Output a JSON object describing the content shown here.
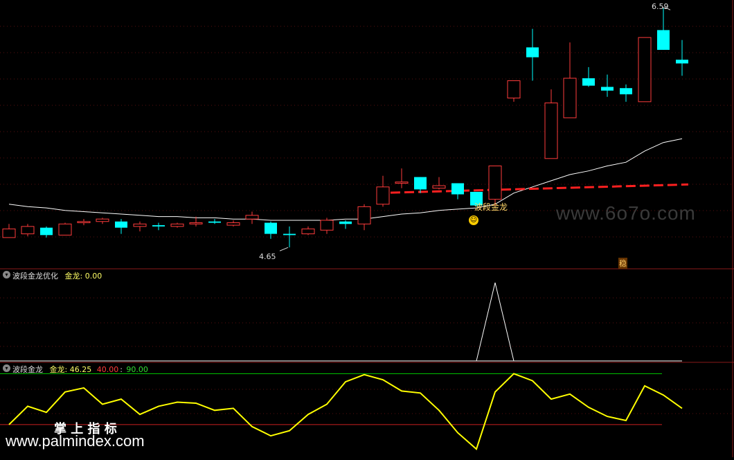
{
  "main_panel": {
    "high_label": "6.59",
    "low_label": "4.65",
    "signal_label": "波段金龙",
    "marker_label": "稳"
  },
  "indicator1": {
    "name": "波段金龙优化",
    "field": "金龙: 0.00"
  },
  "indicator2": {
    "name": "波段金龙",
    "field": "金龙: 46.25",
    "level_low": "40.00",
    "level_high": "90.00"
  },
  "watermarks": {
    "site1": "www.6o7o.com",
    "brand": "掌 上 指 标",
    "site2": "www.palmindex.com"
  },
  "colors": {
    "up": "#ff3b3b",
    "down": "#00ffff",
    "ma": "#ffffff",
    "dashed": "#ff2020",
    "osc": "#ffff00",
    "level_high": "#00cc00",
    "level_low": "#cc2020"
  },
  "chart_data": [
    {
      "type": "candlestick",
      "title": "",
      "ylim": [
        4.55,
        6.62
      ],
      "candles": [
        {
          "o": 4.73,
          "h": 4.84,
          "l": 4.73,
          "c": 4.8,
          "dir": "up"
        },
        {
          "o": 4.76,
          "h": 4.84,
          "l": 4.74,
          "c": 4.82,
          "dir": "up"
        },
        {
          "o": 4.81,
          "h": 4.82,
          "l": 4.73,
          "c": 4.75,
          "dir": "down"
        },
        {
          "o": 4.75,
          "h": 4.85,
          "l": 4.75,
          "c": 4.84,
          "dir": "up"
        },
        {
          "o": 4.85,
          "h": 4.88,
          "l": 4.83,
          "c": 4.86,
          "dir": "up"
        },
        {
          "o": 4.88,
          "h": 4.89,
          "l": 4.84,
          "c": 4.86,
          "dir": "up"
        },
        {
          "o": 4.86,
          "h": 4.88,
          "l": 4.76,
          "c": 4.81,
          "dir": "down"
        },
        {
          "o": 4.82,
          "h": 4.86,
          "l": 4.78,
          "c": 4.84,
          "dir": "up"
        },
        {
          "o": 4.83,
          "h": 4.85,
          "l": 4.79,
          "c": 4.82,
          "dir": "down"
        },
        {
          "o": 4.82,
          "h": 4.85,
          "l": 4.81,
          "c": 4.84,
          "dir": "up"
        },
        {
          "o": 4.84,
          "h": 4.9,
          "l": 4.82,
          "c": 4.85,
          "dir": "up"
        },
        {
          "o": 4.86,
          "h": 4.88,
          "l": 4.84,
          "c": 4.85,
          "dir": "down"
        },
        {
          "o": 4.83,
          "h": 4.87,
          "l": 4.82,
          "c": 4.85,
          "dir": "up"
        },
        {
          "o": 4.88,
          "h": 4.94,
          "l": 4.84,
          "c": 4.91,
          "dir": "up"
        },
        {
          "o": 4.85,
          "h": 4.86,
          "l": 4.72,
          "c": 4.76,
          "dir": "down"
        },
        {
          "o": 4.75,
          "h": 4.82,
          "l": 4.65,
          "c": 4.76,
          "dir": "down"
        },
        {
          "o": 4.76,
          "h": 4.82,
          "l": 4.75,
          "c": 4.8,
          "dir": "up"
        },
        {
          "o": 4.79,
          "h": 4.89,
          "l": 4.76,
          "c": 4.87,
          "dir": "up"
        },
        {
          "o": 4.86,
          "h": 4.87,
          "l": 4.8,
          "c": 4.84,
          "dir": "down"
        },
        {
          "o": 4.84,
          "h": 5.0,
          "l": 4.79,
          "c": 4.98,
          "dir": "up"
        },
        {
          "o": 5.0,
          "h": 5.23,
          "l": 4.98,
          "c": 5.14,
          "dir": "up"
        },
        {
          "o": 5.17,
          "h": 5.29,
          "l": 5.13,
          "c": 5.18,
          "dir": "up"
        },
        {
          "o": 5.22,
          "h": 5.22,
          "l": 5.09,
          "c": 5.12,
          "dir": "down"
        },
        {
          "o": 5.13,
          "h": 5.22,
          "l": 5.12,
          "c": 5.15,
          "dir": "up"
        },
        {
          "o": 5.17,
          "h": 5.17,
          "l": 5.04,
          "c": 5.08,
          "dir": "down"
        },
        {
          "o": 5.1,
          "h": 5.1,
          "l": 4.98,
          "c": 4.99,
          "dir": "down"
        },
        {
          "o": 5.04,
          "h": 5.31,
          "l": 4.99,
          "c": 5.31,
          "dir": "up"
        },
        {
          "o": 5.86,
          "h": 6.0,
          "l": 5.83,
          "c": 6.0,
          "dir": "up"
        },
        {
          "o": 6.27,
          "h": 6.42,
          "l": 6.0,
          "c": 6.19,
          "dir": "down"
        },
        {
          "o": 5.37,
          "h": 5.93,
          "l": 5.37,
          "c": 5.82,
          "dir": "up"
        },
        {
          "o": 5.7,
          "h": 6.31,
          "l": 5.7,
          "c": 6.02,
          "dir": "up"
        },
        {
          "o": 6.02,
          "h": 6.11,
          "l": 5.95,
          "c": 5.96,
          "dir": "down"
        },
        {
          "o": 5.95,
          "h": 6.05,
          "l": 5.87,
          "c": 5.92,
          "dir": "down"
        },
        {
          "o": 5.94,
          "h": 5.97,
          "l": 5.83,
          "c": 5.89,
          "dir": "down"
        },
        {
          "o": 5.83,
          "h": 6.35,
          "l": 5.83,
          "c": 6.35,
          "dir": "up"
        },
        {
          "o": 6.41,
          "h": 6.59,
          "l": 6.25,
          "c": 6.25,
          "dir": "down"
        },
        {
          "o": 6.17,
          "h": 6.33,
          "l": 6.04,
          "c": 6.14,
          "dir": "down"
        }
      ],
      "ma": [
        5.0,
        4.98,
        4.97,
        4.95,
        4.94,
        4.93,
        4.92,
        4.91,
        4.9,
        4.9,
        4.89,
        4.89,
        4.88,
        4.88,
        4.87,
        4.87,
        4.87,
        4.87,
        4.88,
        4.88,
        4.9,
        4.92,
        4.93,
        4.95,
        4.96,
        4.97,
        5.0,
        5.09,
        5.14,
        5.19,
        5.24,
        5.27,
        5.31,
        5.34,
        5.43,
        5.5,
        5.53
      ],
      "dashed_level": {
        "start_index": 20,
        "start": 5.09,
        "end": 5.16
      }
    },
    {
      "type": "line",
      "title": "",
      "ylim": [
        0,
        100
      ],
      "values": [
        0,
        0,
        0,
        0,
        0,
        0,
        0,
        0,
        0,
        0,
        0,
        0,
        0,
        0,
        0,
        0,
        0,
        0,
        0,
        0,
        0,
        0,
        0,
        0,
        0,
        0,
        100,
        0,
        0,
        0,
        0,
        0,
        0,
        0,
        0,
        0,
        0
      ]
    },
    {
      "type": "line",
      "title": "",
      "ylim": [
        10,
        95
      ],
      "levels": [
        40,
        90
      ],
      "values": [
        40,
        58,
        52,
        72,
        76,
        60,
        65,
        50,
        58,
        62,
        61,
        54,
        56,
        38,
        29,
        34,
        50,
        60,
        82,
        89,
        84,
        73,
        71,
        54,
        32,
        16,
        72,
        90,
        83,
        65,
        70,
        57,
        48,
        44,
        78,
        69,
        56
      ]
    }
  ]
}
